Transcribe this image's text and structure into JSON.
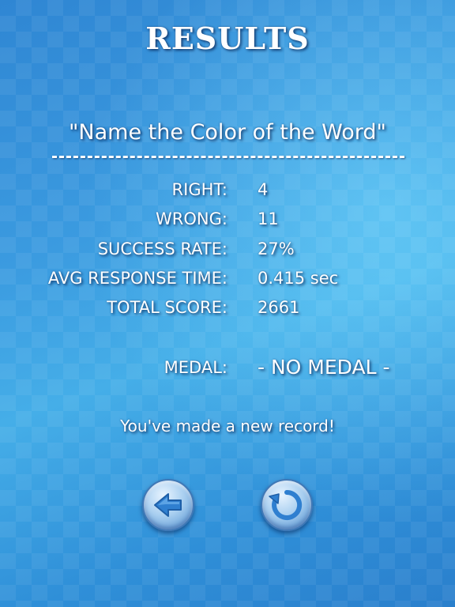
{
  "screen": {
    "title": "RESULTS",
    "game_name": "\"Name the Color of the Word\"",
    "stats": [
      {
        "label": "RIGHT:",
        "value": "4"
      },
      {
        "label": "WRONG:",
        "value": "11"
      },
      {
        "label": "SUCCESS RATE:",
        "value": "27%"
      },
      {
        "label": "AVG RESPONSE TIME:",
        "value": "0.415 sec"
      },
      {
        "label": "TOTAL SCORE:",
        "value": "2661"
      }
    ],
    "medal": {
      "label": "MEDAL:",
      "value": "- NO MEDAL -"
    },
    "record_message": "You've made a new record!"
  },
  "buttons": {
    "back": {
      "icon": "arrow-left-icon"
    },
    "retry": {
      "icon": "refresh-icon"
    }
  },
  "colors": {
    "background": "#3b9be0",
    "text": "#ffffff",
    "button_face": "#a9cff0",
    "icon": "#2f7fd0"
  }
}
